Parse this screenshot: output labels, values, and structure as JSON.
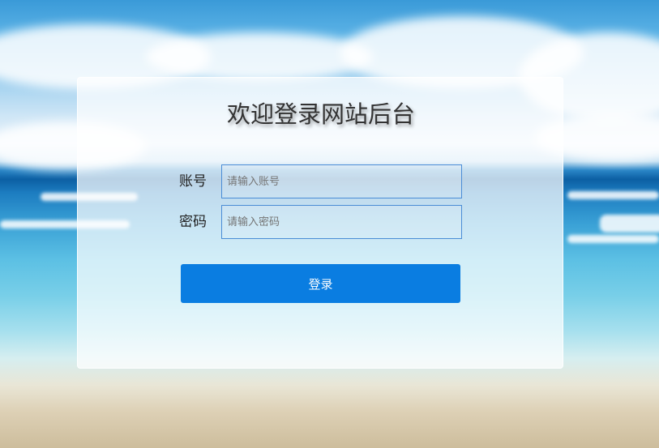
{
  "login": {
    "title": "欢迎登录网站后台",
    "account_label": "账号",
    "account_placeholder": "请输入账号",
    "password_label": "密码",
    "password_placeholder": "请输入密码",
    "submit_label": "登录"
  },
  "colors": {
    "button": "#0a7de1",
    "input_border": "#4a8cd6"
  }
}
